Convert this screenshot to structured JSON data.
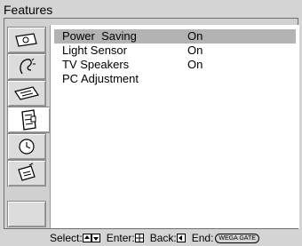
{
  "window": {
    "title": "Features"
  },
  "sidebar": {
    "items": [
      {
        "icon": "picture-icon"
      },
      {
        "icon": "sound-icon"
      },
      {
        "icon": "screen-icon"
      },
      {
        "icon": "features-icon",
        "active": true
      },
      {
        "icon": "timer-icon"
      },
      {
        "icon": "setup-icon"
      },
      {
        "icon": "blank"
      }
    ]
  },
  "menu": {
    "items": [
      {
        "label": "Power  Saving",
        "value": "On",
        "selected": true
      },
      {
        "label": "Light Sensor",
        "value": "On"
      },
      {
        "label": "TV Speakers",
        "value": "On"
      },
      {
        "label": "PC Adjustment",
        "value": ""
      }
    ]
  },
  "footer": {
    "select_label": "Select:",
    "enter_label": "Enter:",
    "back_label": "Back:",
    "end_label": "End:",
    "end_key": "WEGA GATE"
  }
}
